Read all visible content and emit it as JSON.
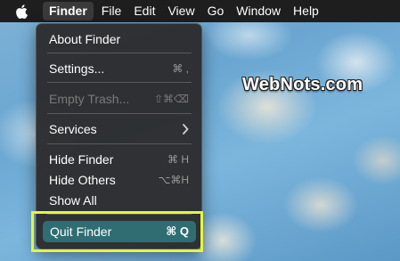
{
  "menubar": {
    "apple_icon": "apple-logo-icon",
    "menus": [
      {
        "label": "Finder"
      },
      {
        "label": "File"
      },
      {
        "label": "Edit"
      },
      {
        "label": "View"
      },
      {
        "label": "Go"
      },
      {
        "label": "Window"
      },
      {
        "label": "Help"
      }
    ]
  },
  "watermark": "WebNots.com",
  "finder_menu": {
    "about": {
      "label": "About Finder"
    },
    "settings": {
      "label": "Settings...",
      "shortcut": "⌘ ,"
    },
    "empty_trash": {
      "label": "Empty Trash...",
      "shortcut": "⇧⌘⌫"
    },
    "services": {
      "label": "Services",
      "submenu_icon": "chevron-right-icon"
    },
    "hide_finder": {
      "label": "Hide Finder",
      "shortcut": "⌘ H"
    },
    "hide_others": {
      "label": "Hide Others",
      "shortcut": "⌥⌘H"
    },
    "show_all": {
      "label": "Show All"
    },
    "quit": {
      "label": "Quit Finder",
      "shortcut": "⌘ Q"
    }
  },
  "colors": {
    "menubar_bg": "#1e1e1e",
    "menu_bg": "#2c2c2e",
    "selection": "#2f6d73",
    "highlight_box": "#e6f53a"
  }
}
